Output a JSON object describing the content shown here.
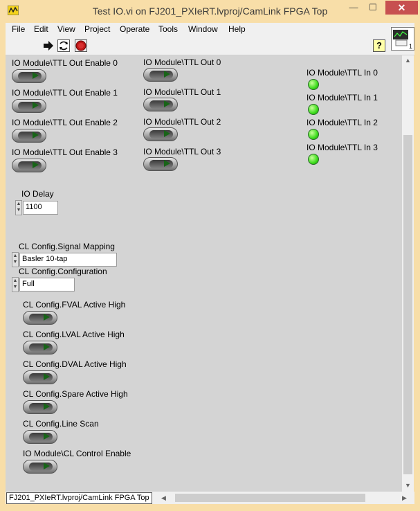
{
  "window": {
    "title": "Test IO.vi on FJ201_PXIeRT.lvproj/CamLink FPGA Top",
    "minimize_glyph": "—",
    "maximize_glyph": "☐",
    "close_glyph": "✕"
  },
  "menu": {
    "items": [
      "File",
      "Edit",
      "View",
      "Project",
      "Operate",
      "Tools",
      "Window",
      "Help"
    ]
  },
  "toolbar": {
    "run_icon": "run-arrow-icon",
    "continuous_icon": "run-continuously-icon",
    "abort_icon": "abort-icon",
    "help_glyph": "?",
    "vi_icon_glyph": "1"
  },
  "panel": {
    "col1": [
      "IO Module\\TTL Out Enable 0",
      "IO Module\\TTL Out Enable 1",
      "IO Module\\TTL Out Enable 2",
      "IO Module\\TTL Out Enable 3"
    ],
    "col2": [
      "IO Module\\TTL Out 0",
      "IO Module\\TTL Out 1",
      "IO Module\\TTL Out 2",
      "IO Module\\TTL Out 3"
    ],
    "col3": [
      "IO Module\\TTL In 0",
      "IO Module\\TTL In 1",
      "IO Module\\TTL In 2",
      "IO Module\\TTL In 3"
    ],
    "io_delay": {
      "label": "IO Delay",
      "value": "1100"
    },
    "signal_mapping": {
      "label": "CL Config.Signal Mapping",
      "value": "Basler 10-tap"
    },
    "configuration": {
      "label": "CL Config.Configuration",
      "value": "Full"
    },
    "cl_switches": [
      "CL Config.FVAL Active High",
      "CL Config.LVAL Active High",
      "CL Config.DVAL Active High",
      "CL Config.Spare Active High",
      "CL Config.Line Scan",
      "IO Module\\CL Control Enable"
    ],
    "spin_up": "▲",
    "spin_down": "▼"
  },
  "status": {
    "path": "FJ201_PXIeRT.lvproj/CamLink FPGA Top",
    "left_arrow": "◀",
    "right_arrow": "▶",
    "up_arrow": "▲",
    "down_arrow": "▼"
  },
  "colors": {
    "frame": "#f8dea8",
    "panel": "#d4d4d4",
    "led_on": "#3cdc1c",
    "close_button": "#c75050"
  }
}
